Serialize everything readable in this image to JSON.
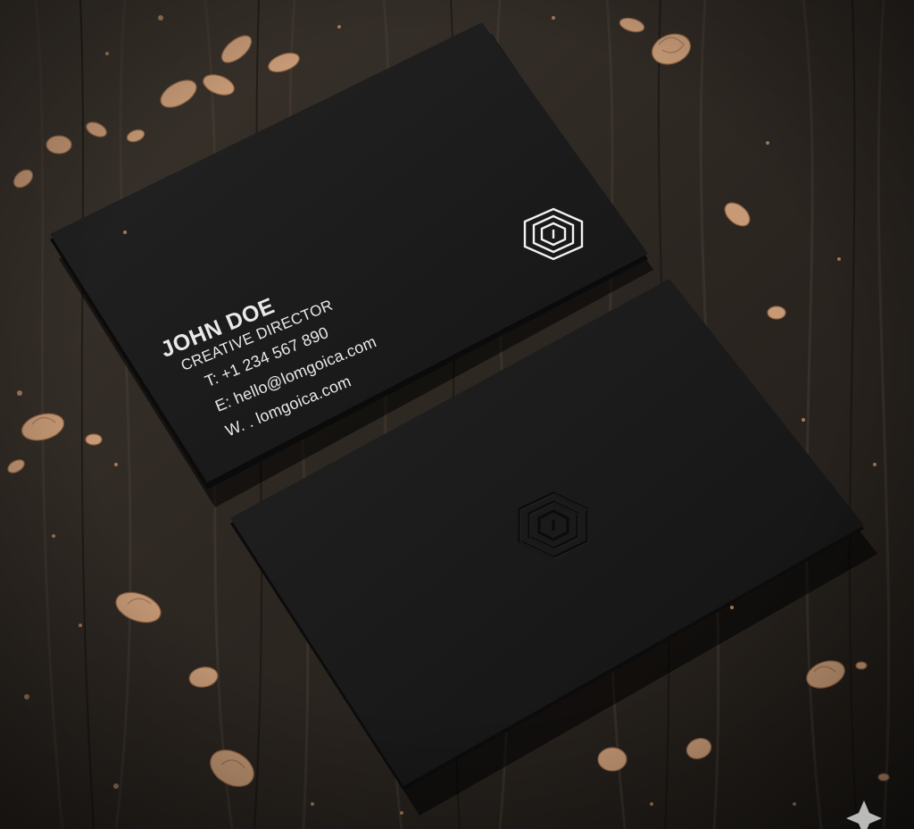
{
  "scene": {
    "description_colors": {
      "wood_dark": "#231e19",
      "wood_mid": "#3a332c",
      "card": "#1a1a1a",
      "card_edge": "#0d0d0d",
      "text": "#e9e9e9",
      "shaving": "#c79a76"
    }
  },
  "front_card": {
    "name": "JOHN DOE",
    "title": "CREATIVE DIRECTOR",
    "phone": "T: +1 234 567 890",
    "email": "E: hello@lomgoica.com",
    "web": "W. . lomgoica.com",
    "logo": "hexagon-maze-logo"
  },
  "back_card": {
    "logo": "embossed-hexagon-maze-logo"
  }
}
